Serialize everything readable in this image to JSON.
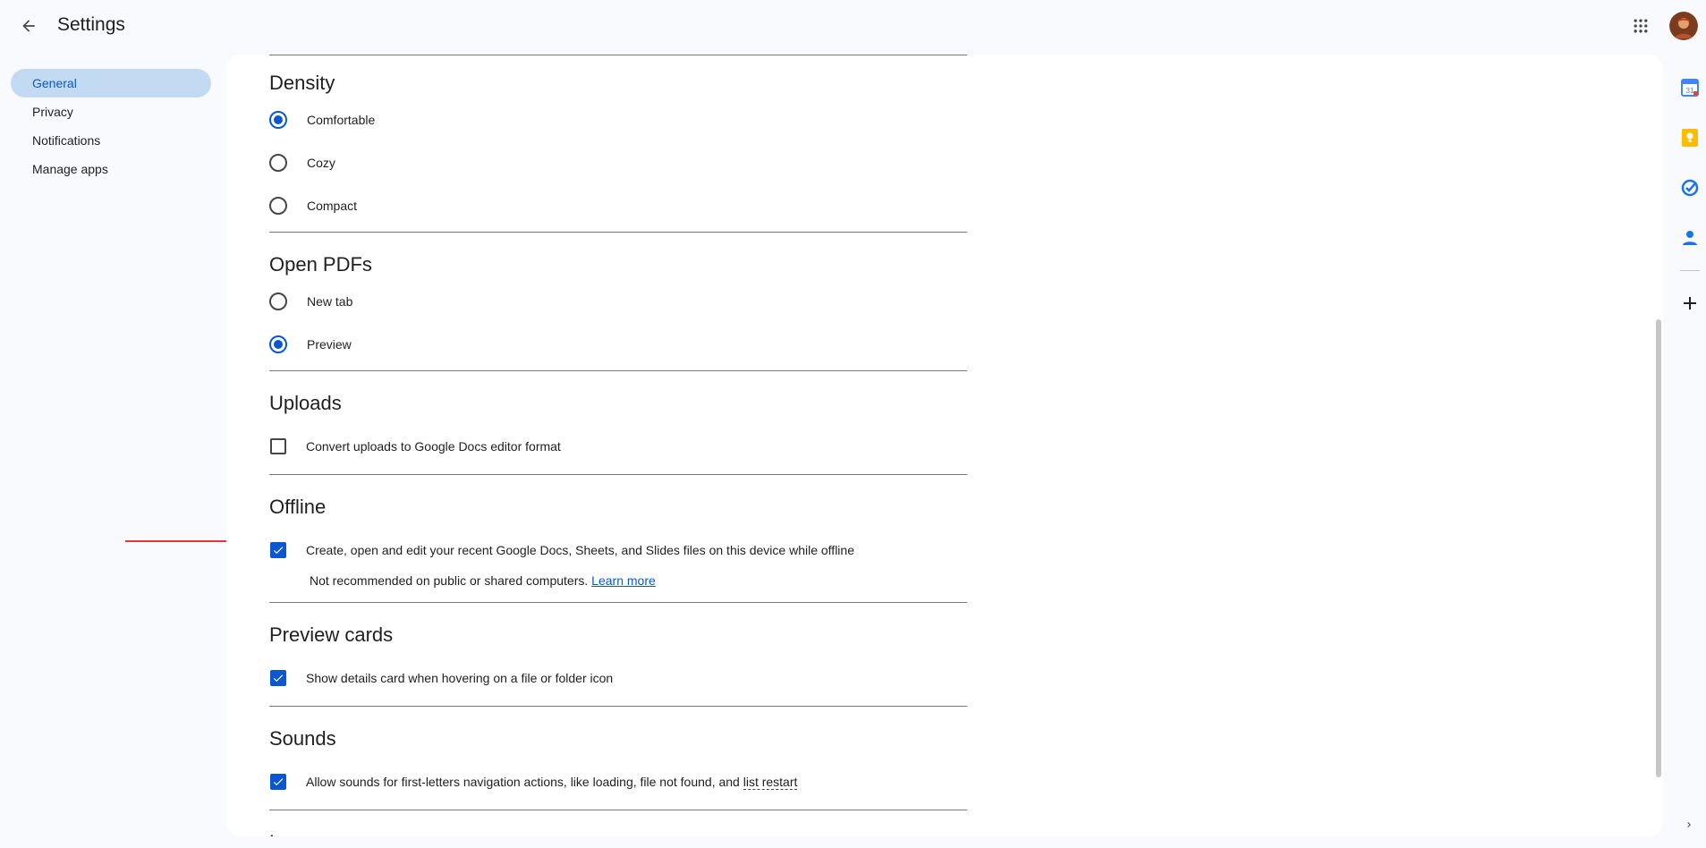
{
  "header": {
    "title": "Settings",
    "back_icon": "arrow-back-icon",
    "apps_icon": "apps-grid-icon"
  },
  "nav": {
    "items": [
      {
        "label": "General",
        "active": true
      },
      {
        "label": "Privacy",
        "active": false
      },
      {
        "label": "Notifications",
        "active": false
      },
      {
        "label": "Manage apps",
        "active": false
      }
    ]
  },
  "sections": {
    "density": {
      "title": "Density",
      "options": [
        "Comfortable",
        "Cozy",
        "Compact"
      ],
      "selected": "Comfortable"
    },
    "open_pdfs": {
      "title": "Open PDFs",
      "options": [
        "New tab",
        "Preview"
      ],
      "selected": "Preview"
    },
    "uploads": {
      "title": "Uploads",
      "option": "Convert uploads to Google Docs editor format",
      "checked": false
    },
    "offline": {
      "title": "Offline",
      "option": "Create, open and edit your recent Google Docs, Sheets, and Slides files on this device while offline",
      "checked": true,
      "note": "Not recommended on public or shared computers.",
      "link": "Learn more"
    },
    "preview_cards": {
      "title": "Preview cards",
      "option": "Show details card when hovering on a file or folder icon",
      "checked": true
    },
    "sounds": {
      "title": "Sounds",
      "option_prefix": "Allow sounds for first-letters navigation actions, like loading, file not found, and ",
      "option_dotted": "list restart",
      "checked": true
    },
    "language": {
      "title": "Language"
    }
  },
  "side_panel": {
    "icons": [
      "calendar-icon",
      "keep-icon",
      "tasks-icon",
      "contacts-icon"
    ],
    "add_icon": "plus-icon",
    "expand_icon": "chevron-right-icon"
  },
  "colors": {
    "accent": "#0b57d0",
    "nav_active_bg": "#c2dbf3",
    "annotation_arrow": "#e53935"
  }
}
